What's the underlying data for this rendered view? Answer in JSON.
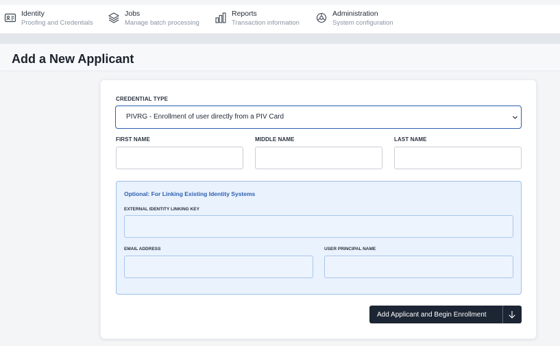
{
  "nav": {
    "items": [
      {
        "title": "Identity",
        "subtitle": "Proofing and Credentials",
        "icon": "id-card-icon"
      },
      {
        "title": "Jobs",
        "subtitle": "Manage batch processing",
        "icon": "layers-icon"
      },
      {
        "title": "Reports",
        "subtitle": "Transaction information",
        "icon": "bar-chart-icon"
      },
      {
        "title": "Administration",
        "subtitle": "System configuration",
        "icon": "settings-icon"
      }
    ]
  },
  "page": {
    "title": "Add a New Applicant"
  },
  "form": {
    "credential_type_label": "CREDENTIAL TYPE",
    "credential_type_value": "PIVRG - Enrollment of user directly from a PIV Card",
    "first_name_label": "FIRST NAME",
    "first_name_value": "",
    "middle_name_label": "MIDDLE NAME",
    "middle_name_value": "",
    "last_name_label": "LAST NAME",
    "last_name_value": "",
    "optional": {
      "title": "Optional: For Linking Existing Identity Systems",
      "linking_key_label": "EXTERNAL IDENTITY LINKING KEY",
      "linking_key_value": "",
      "email_label": "EMAIL ADDRESS",
      "email_value": "",
      "upn_label": "USER PRINCIPAL NAME",
      "upn_value": ""
    },
    "submit_label": "Add Applicant and Begin Enrollment",
    "submit_dropdown_icon": "arrow-down-icon"
  },
  "colors": {
    "accent": "#2a5fb0",
    "button_bg": "#1c2533",
    "optional_bg": "#eaf2fd"
  }
}
